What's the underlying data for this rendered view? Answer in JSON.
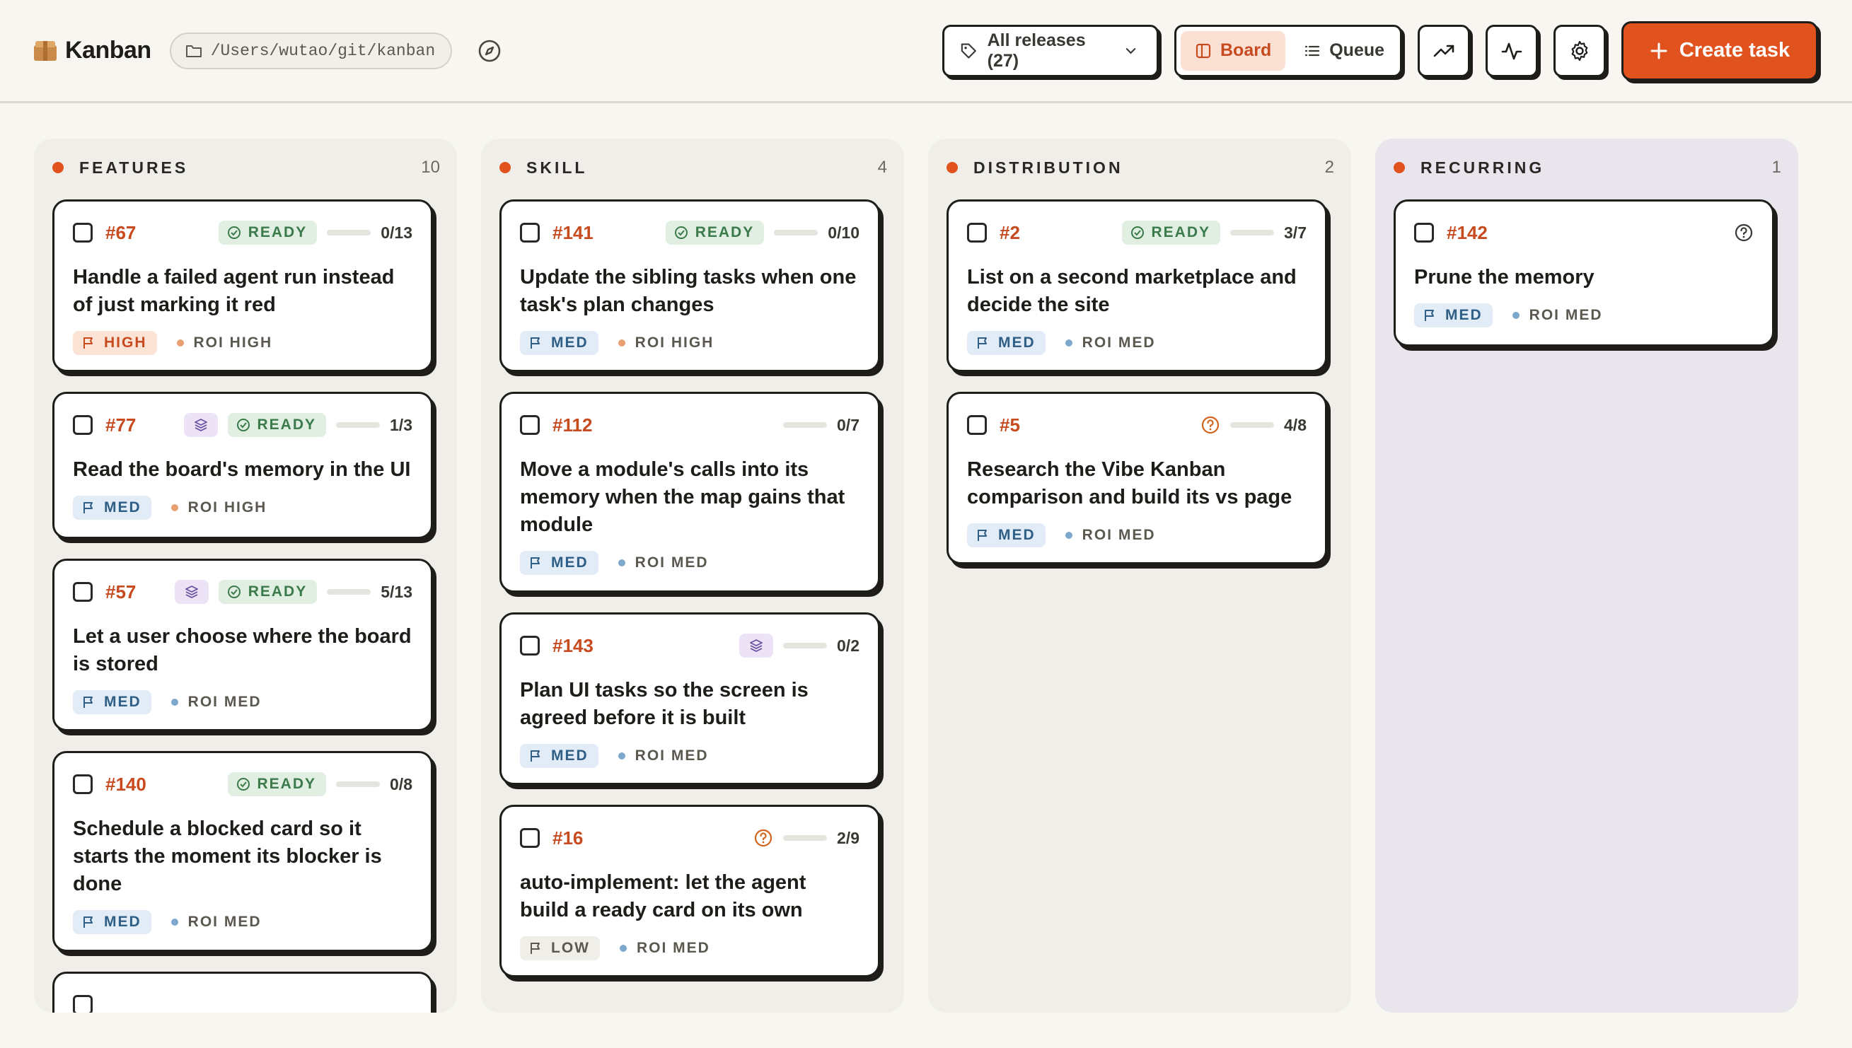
{
  "header": {
    "title": "Kanban",
    "path": "/Users/wutao/git/kanban",
    "release_filter": "All releases (27)",
    "view_board": "Board",
    "view_queue": "Queue",
    "create_label": "Create task"
  },
  "columns": [
    {
      "title": "FEATURES",
      "count": "10",
      "cards": [
        {
          "id": "#67",
          "ready": "READY",
          "progress": "0/13",
          "progress_fraction": 0,
          "title": "Handle a failed agent run instead of just marking it red",
          "priority": "HIGH",
          "roi": "ROI HIGH"
        },
        {
          "id": "#77",
          "ready": "READY",
          "progress": "1/3",
          "progress_fraction": 0.33,
          "title": "Read the board's memory in the UI",
          "priority": "MED",
          "roi": "ROI HIGH"
        },
        {
          "id": "#57",
          "ready": "READY",
          "progress": "5/13",
          "progress_fraction": 0.38,
          "title": "Let a user choose where the board is stored",
          "priority": "MED",
          "roi": "ROI MED"
        },
        {
          "id": "#140",
          "ready": "READY",
          "progress": "0/8",
          "progress_fraction": 0,
          "title": "Schedule a blocked card so it starts the moment its blocker is done",
          "priority": "MED",
          "roi": "ROI MED"
        }
      ]
    },
    {
      "title": "SKILL",
      "count": "4",
      "cards": [
        {
          "id": "#141",
          "ready": "READY",
          "progress": "0/10",
          "progress_fraction": 0,
          "title": "Update the sibling tasks when one task's plan changes",
          "priority": "MED",
          "roi": "ROI HIGH"
        },
        {
          "id": "#112",
          "progress": "0/7",
          "progress_fraction": 0,
          "title": "Move a module's calls into its memory when the map gains that module",
          "priority": "MED",
          "roi": "ROI MED"
        },
        {
          "id": "#143",
          "progress": "0/2",
          "progress_fraction": 0,
          "title": "Plan UI tasks so the screen is agreed before it is built",
          "priority": "MED",
          "roi": "ROI MED"
        },
        {
          "id": "#16",
          "progress": "2/9",
          "progress_fraction": 0.22,
          "title": "auto-implement: let the agent build a ready card on its own",
          "priority": "LOW",
          "roi": "ROI MED"
        }
      ]
    },
    {
      "title": "DISTRIBUTION",
      "count": "2",
      "cards": [
        {
          "id": "#2",
          "ready": "READY",
          "progress": "3/7",
          "progress_fraction": 0.43,
          "title": "List on a second marketplace and decide the site",
          "priority": "MED",
          "roi": "ROI MED"
        },
        {
          "id": "#5",
          "progress": "4/8",
          "progress_fraction": 0.5,
          "title": "Research the Vibe Kanban comparison and build its vs page",
          "priority": "MED",
          "roi": "ROI MED"
        }
      ]
    },
    {
      "title": "RECURRING",
      "count": "1",
      "cards": [
        {
          "id": "#142",
          "title": "Prune the memory",
          "priority": "MED",
          "roi": "ROI MED"
        }
      ]
    }
  ],
  "colors": {
    "accent": "#e0531f",
    "ready_green": "#3b7a4a",
    "med_blue": "#2f5e86"
  }
}
